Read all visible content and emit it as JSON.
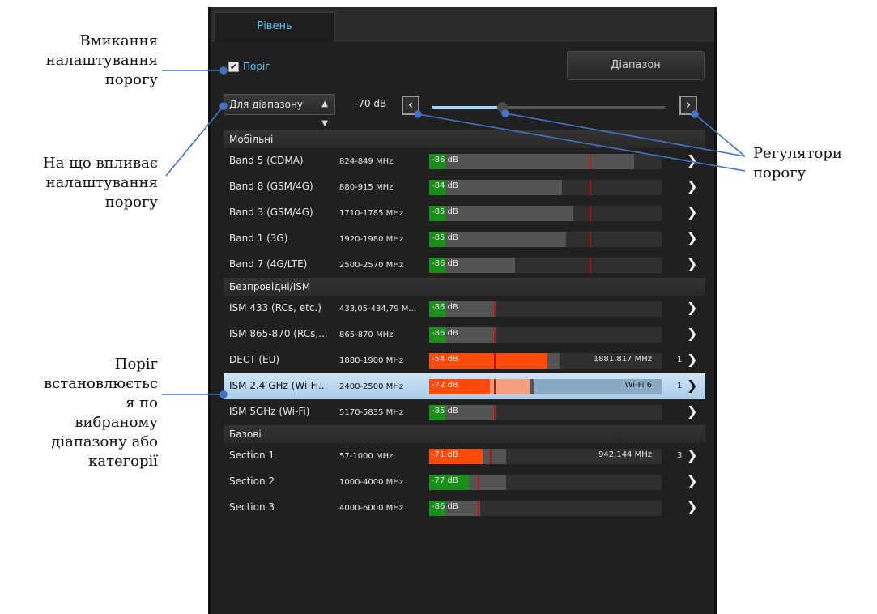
{
  "annotations": {
    "toggle": [
      "Вмикання",
      "налаштування",
      "порогу"
    ],
    "scope": [
      "На що впливає",
      "налаштування",
      "порогу"
    ],
    "selected": [
      "Поріг",
      "встановлюєтьс",
      "я по",
      "вибраному",
      "діапазону або",
      "категорії"
    ],
    "controls": [
      "Регулятори",
      "порогу"
    ]
  },
  "tab": {
    "label": "Рівень"
  },
  "toolbar": {
    "threshold_checkbox": {
      "label": "Поріг",
      "checked": true
    },
    "range_button": "Діапазон",
    "scope_select": "Для діапазону",
    "threshold_value": "-70 dB",
    "slider_fraction": 0.3,
    "decrease_icon": "chevron-left-icon",
    "increase_icon": "chevron-right-icon"
  },
  "sections": [
    {
      "title": "Мобільні",
      "rows": [
        {
          "name": "Band 5 (CDMA)",
          "freq": "824-849 MHz",
          "db": "-86 dB",
          "level": 0.88,
          "fill": 0.07,
          "fill_color": "#1a8f1a",
          "threshold": 0.69,
          "info": "",
          "count": "",
          "selected": false
        },
        {
          "name": "Band 8 (GSM/4G)",
          "freq": "880-915 MHz",
          "db": "-84 dB",
          "level": 0.57,
          "fill": 0.07,
          "fill_color": "#1a8f1a",
          "threshold": 0.69,
          "info": "",
          "count": "",
          "selected": false
        },
        {
          "name": "Band 3 (GSM/4G)",
          "freq": "1710-1785 MHz",
          "db": "-85 dB",
          "level": 0.62,
          "fill": 0.07,
          "fill_color": "#1a8f1a",
          "threshold": 0.69,
          "info": "",
          "count": "",
          "selected": false
        },
        {
          "name": "Band 1 (3G)",
          "freq": "1920-1980 MHz",
          "db": "-85 dB",
          "level": 0.59,
          "fill": 0.07,
          "fill_color": "#1a8f1a",
          "threshold": 0.69,
          "info": "",
          "count": "",
          "selected": false
        },
        {
          "name": "Band 7 (4G/LTE)",
          "freq": "2500-2570 MHz",
          "db": "-86 dB",
          "level": 0.37,
          "fill": 0.07,
          "fill_color": "#1a8f1a",
          "threshold": 0.69,
          "info": "",
          "count": "",
          "selected": false
        }
      ]
    },
    {
      "title": "Безпровідні/ISM",
      "rows": [
        {
          "name": "ISM 433 (RCs, etc.)",
          "freq": "433,05-434,79 M...",
          "db": "-86 dB",
          "level": 0.29,
          "fill": 0.07,
          "fill_color": "#1a8f1a",
          "threshold": 0.28,
          "info": "",
          "count": "",
          "selected": false
        },
        {
          "name": "ISM 865-870 (RCs,...",
          "freq": "865-870 MHz",
          "db": "-86 dB",
          "level": 0.29,
          "fill": 0.07,
          "fill_color": "#1a8f1a",
          "threshold": 0.28,
          "info": "",
          "count": "",
          "selected": false
        },
        {
          "name": "DECT (EU)",
          "freq": "1880-1900 MHz",
          "db": "-54 dB",
          "level": 0.56,
          "fill": 0.51,
          "fill_color": "#ff4a0a",
          "threshold": 0.28,
          "info": "1881,817 MHz",
          "count": "1",
          "selected": false
        },
        {
          "name": "ISM 2.4 GHz (Wi-Fi...",
          "freq": "2400-2500 MHz",
          "db": "-72 dB",
          "level": 0.45,
          "fill": 0.26,
          "fill_color": "#ff4a0a",
          "threshold": 0.28,
          "info": "Wi-Fi 6",
          "count": "1",
          "selected": true
        },
        {
          "name": "ISM 5GHz (Wi-Fi)",
          "freq": "5170-5835 MHz",
          "db": "-85 dB",
          "level": 0.29,
          "fill": 0.07,
          "fill_color": "#1a8f1a",
          "threshold": 0.28,
          "info": "",
          "count": "",
          "selected": false
        }
      ]
    },
    {
      "title": "Базові",
      "rows": [
        {
          "name": "Section 1",
          "freq": "57-1000 MHz",
          "db": "-71 dB",
          "level": 0.33,
          "fill": 0.23,
          "fill_color": "#ff4a0a",
          "threshold": 0.26,
          "info": "942,144 MHz",
          "count": "3",
          "selected": false
        },
        {
          "name": "Section 2",
          "freq": "1000-4000 MHz",
          "db": "-77 dB",
          "level": 0.33,
          "fill": 0.17,
          "fill_color": "#1a8f1a",
          "threshold": 0.21,
          "info": "",
          "count": "",
          "selected": false
        },
        {
          "name": "Section 3",
          "freq": "4000-6000 MHz",
          "db": "-86 dB",
          "level": 0.22,
          "fill": 0.07,
          "fill_color": "#1a8f1a",
          "threshold": 0.21,
          "info": "",
          "count": "",
          "selected": false
        }
      ]
    }
  ]
}
